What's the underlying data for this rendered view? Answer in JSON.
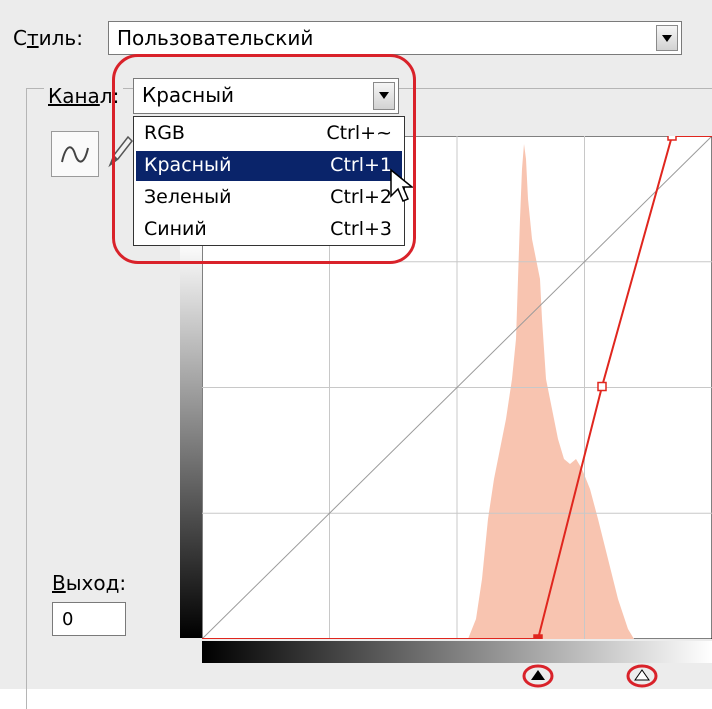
{
  "style_row": {
    "label_prefix": "С",
    "label_underlined": "т",
    "label_suffix": "иль:",
    "value": "Пользовательский"
  },
  "channel_row": {
    "label_underlined": "Кана",
    "label_suffix": "л:",
    "value": "Красный"
  },
  "channel_menu": {
    "items": [
      {
        "label": "RGB",
        "shortcut": "Ctrl+~",
        "selected": false
      },
      {
        "label": "Красный",
        "shortcut": "Ctrl+1",
        "selected": true
      },
      {
        "label": "Зеленый",
        "shortcut": "Ctrl+2",
        "selected": false
      },
      {
        "label": "Синий",
        "shortcut": "Ctrl+3",
        "selected": false
      }
    ]
  },
  "output": {
    "label_underlined": "В",
    "label_suffix": "ыход:",
    "value": "0"
  },
  "curve": {
    "channel_color": "#e0261e",
    "histogram_color": "#f8c4b0",
    "points": [
      [
        0,
        0
      ],
      [
        168,
        0
      ],
      [
        200,
        128
      ],
      [
        235,
        255
      ],
      [
        255,
        255
      ]
    ]
  },
  "input_sliders": {
    "black_point": 168,
    "white_point": 220
  },
  "colors": {
    "highlight": "#d9222a",
    "menu_selection": "#0a246a"
  }
}
